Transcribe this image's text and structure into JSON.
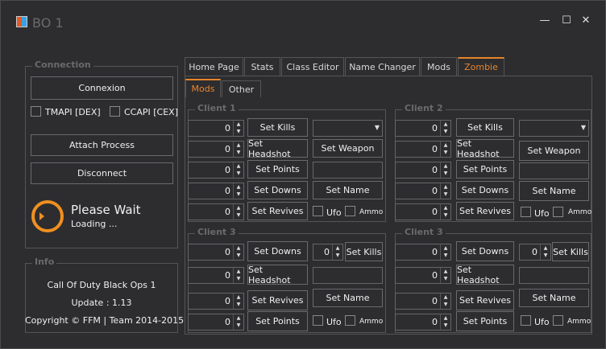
{
  "window": {
    "title": "BO 1",
    "minimize": "—",
    "maximize": "☐",
    "close": "✕"
  },
  "connection": {
    "title": "Connection",
    "connect": "Connexion",
    "tmapi": "TMAPI [DEX]",
    "ccapi": "CCAPI [CEX]",
    "attach": "Attach Process",
    "disconnect": "Disconnect",
    "status": "Please Wait",
    "status_sub": "Loading ..."
  },
  "info": {
    "title": "Info",
    "game": "Call Of Duty Black Ops 1",
    "update": "Update : 1.13",
    "copyright": "Copyright © FFM | Team 2014-2015"
  },
  "tabs": [
    "Home Page",
    "Stats",
    "Class Editor",
    "Name Changer",
    "Mods",
    "Zombie"
  ],
  "subtabs": [
    "Mods",
    "Other"
  ],
  "labels": {
    "set_kills": "Set Kills",
    "set_headshot": "Set Headshot",
    "set_points": "Set Points",
    "set_downs": "Set Downs",
    "set_revives": "Set Revives",
    "set_weapon": "Set Weapon",
    "set_name": "Set Name",
    "ufo": "Ufo",
    "ammo": "Ammo"
  },
  "clients": {
    "c1": "Client 1",
    "c2": "Client 2",
    "c3": "Client 3",
    "c4": "Client 3"
  },
  "zero": "0",
  "icons": {
    "app": "app-icon",
    "spinner": "loading-spinner-icon",
    "up": "▲",
    "down": "▼",
    "dropdown": "▼"
  }
}
